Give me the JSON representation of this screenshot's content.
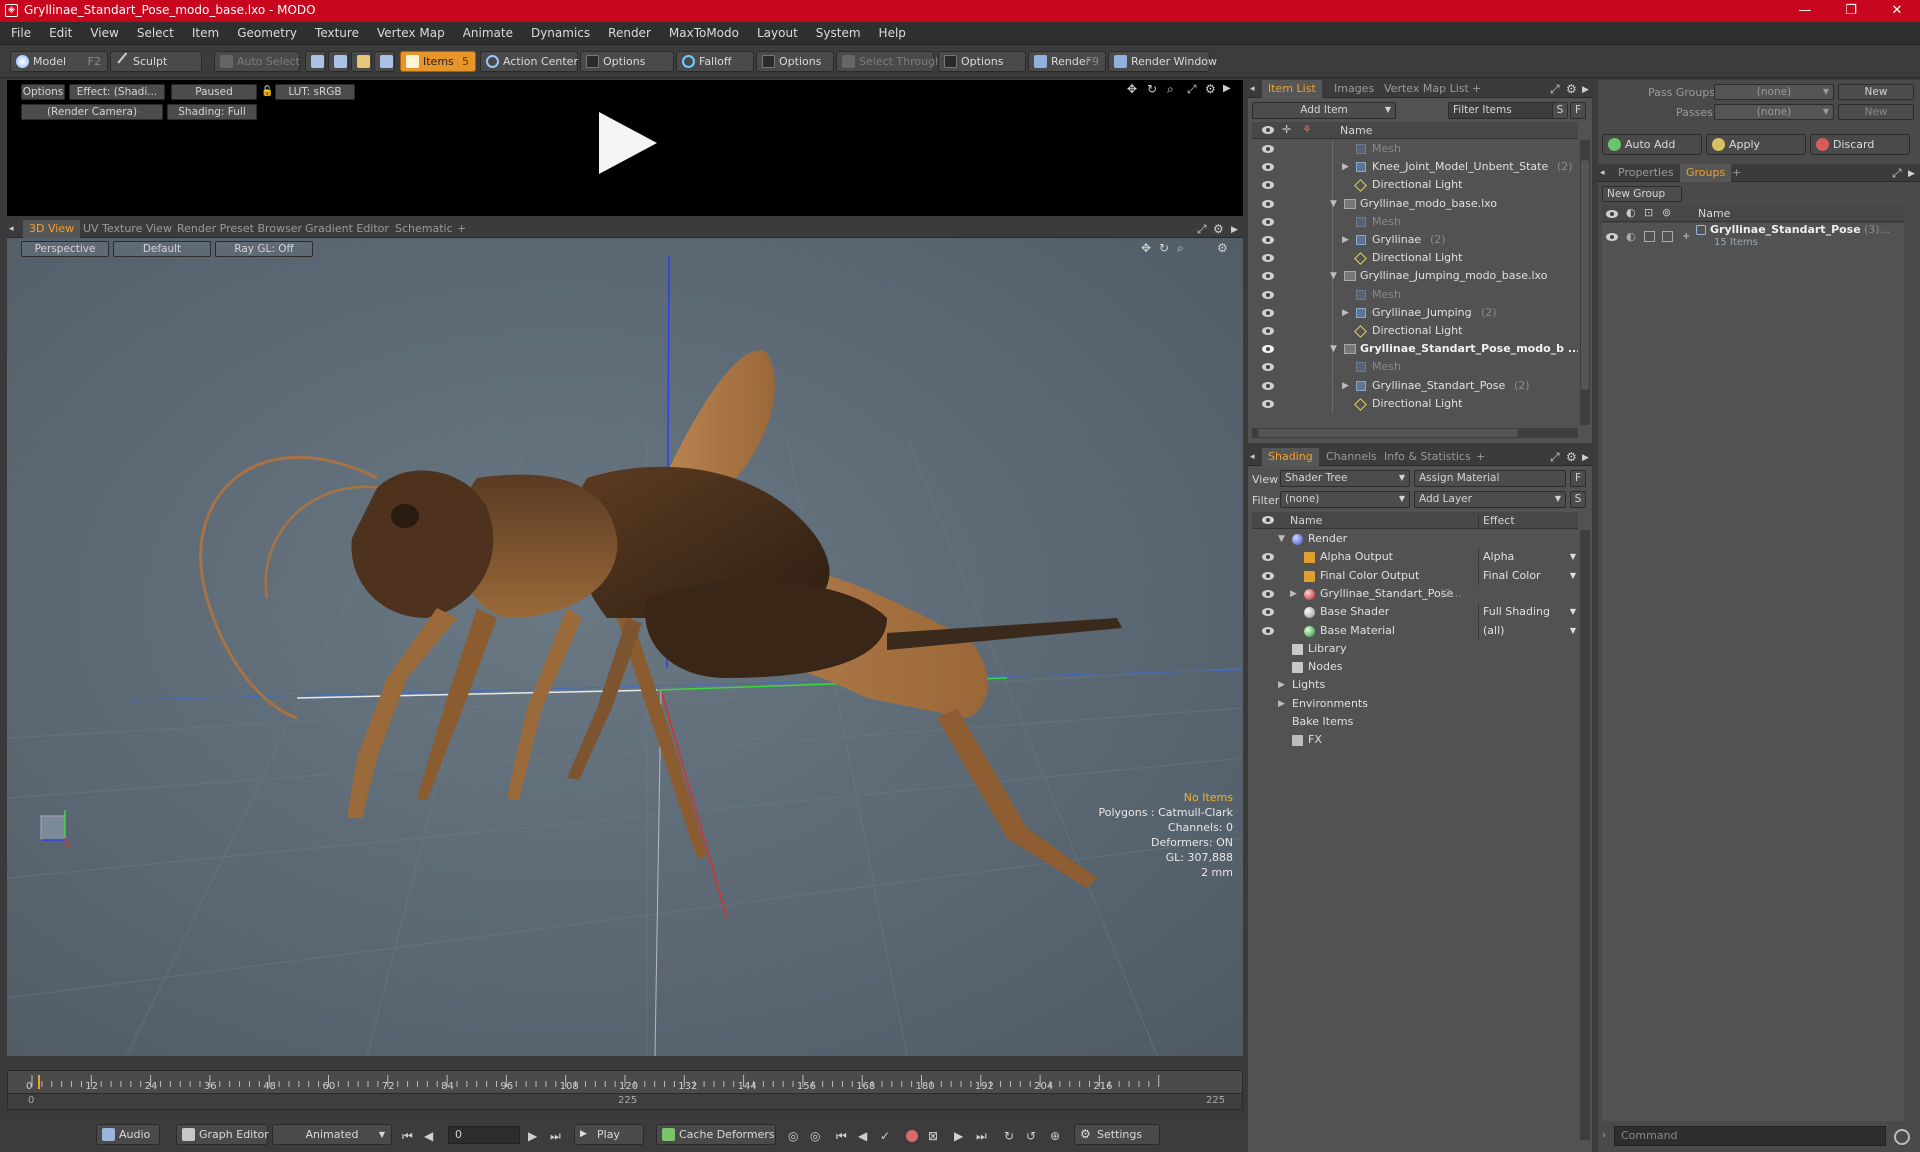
{
  "window": {
    "title": "Gryllinae_Standart_Pose_modo_base.lxo - MODO",
    "minimize": "—",
    "maximize": "❐",
    "close": "✕"
  },
  "menu": [
    "File",
    "Edit",
    "View",
    "Select",
    "Item",
    "Geometry",
    "Texture",
    "Vertex Map",
    "Animate",
    "Dynamics",
    "Render",
    "MaxToModo",
    "Layout",
    "System",
    "Help"
  ],
  "toolbar": {
    "model": "Model",
    "model_key": "F2",
    "sculpt": "Sculpt",
    "auto_select": "Auto Select",
    "items": "Items",
    "items_key": "5",
    "action_center": "Action Center",
    "options1": "Options",
    "falloff": "Falloff",
    "options2": "Options",
    "select_through": "Select Through",
    "options3": "Options",
    "render": "Render",
    "render_key": "F9",
    "render_window": "Render Window"
  },
  "preview": {
    "options": "Options",
    "effect": "Effect: (Shadi...",
    "paused": "Paused",
    "lut": "LUT: sRGB",
    "camera": "(Render Camera)",
    "shading": "Shading: Full"
  },
  "viewport_tabs": [
    "3D View",
    "UV Texture View",
    "Render Preset Browser",
    "Gradient Editor",
    "Schematic",
    "+"
  ],
  "viewport": {
    "perspective": "Perspective",
    "default": "Default",
    "raygl": "Ray GL: Off",
    "info": {
      "no_items": "No Items",
      "polygons": "Polygons : Catmull-Clark",
      "channels": "Channels: 0",
      "deformers": "Deformers: ON",
      "gl": "GL: 307,888",
      "scale": "2 mm"
    }
  },
  "timeline": {
    "ticks": [
      "0",
      "12",
      "24",
      "36",
      "48",
      "60",
      "72",
      "84",
      "96",
      "108",
      "120",
      "132",
      "144",
      "156",
      "168",
      "180",
      "192",
      "204",
      "216"
    ],
    "start": "0",
    "mid": "225",
    "end": "225"
  },
  "transport": {
    "audio": "Audio",
    "graph_editor": "Graph Editor",
    "animated": "Animated",
    "frame": "0",
    "play": "Play",
    "cache": "Cache Deformers",
    "settings": "Settings"
  },
  "item_list": {
    "tabs": [
      "Item List",
      "Images",
      "Vertex Map List",
      "+"
    ],
    "add_item": "Add Item",
    "filter": "Filter Items",
    "s": "S",
    "f": "F",
    "col_name": "Name",
    "rows": [
      {
        "label": "Mesh",
        "count": "",
        "type": "mesh",
        "indent": 2,
        "dim": true,
        "arrow": "",
        "bold": false
      },
      {
        "label": "Knee_Joint_Model_Unbent_State",
        "count": "(2)",
        "type": "mesh",
        "indent": 2,
        "dim": false,
        "arrow": "▶",
        "bold": false
      },
      {
        "label": "Directional Light",
        "count": "",
        "type": "light",
        "indent": 2,
        "dim": false,
        "arrow": "",
        "bold": false
      },
      {
        "label": "Gryllinae_modo_base.lxo",
        "count": "",
        "type": "scene",
        "indent": 1,
        "dim": false,
        "arrow": "▼",
        "bold": false
      },
      {
        "label": "Mesh",
        "count": "",
        "type": "mesh",
        "indent": 2,
        "dim": true,
        "arrow": "",
        "bold": false
      },
      {
        "label": "Gryllinae",
        "count": "(2)",
        "type": "mesh",
        "indent": 2,
        "dim": false,
        "arrow": "▶",
        "bold": false
      },
      {
        "label": "Directional Light",
        "count": "",
        "type": "light",
        "indent": 2,
        "dim": false,
        "arrow": "",
        "bold": false
      },
      {
        "label": "Gryllinae_Jumping_modo_base.lxo",
        "count": "",
        "type": "scene",
        "indent": 1,
        "dim": false,
        "arrow": "▼",
        "bold": false
      },
      {
        "label": "Mesh",
        "count": "",
        "type": "mesh",
        "indent": 2,
        "dim": true,
        "arrow": "",
        "bold": false
      },
      {
        "label": "Gryllinae_Jumping",
        "count": "(2)",
        "type": "mesh",
        "indent": 2,
        "dim": false,
        "arrow": "▶",
        "bold": false
      },
      {
        "label": "Directional Light",
        "count": "",
        "type": "light",
        "indent": 2,
        "dim": false,
        "arrow": "",
        "bold": false
      },
      {
        "label": "Gryllinae_Standart_Pose_modo_b ...",
        "count": "",
        "type": "scene",
        "indent": 1,
        "dim": false,
        "arrow": "▼",
        "bold": true
      },
      {
        "label": "Mesh",
        "count": "",
        "type": "mesh",
        "indent": 2,
        "dim": true,
        "arrow": "",
        "bold": false
      },
      {
        "label": "Gryllinae_Standart_Pose",
        "count": "(2)",
        "type": "mesh",
        "indent": 2,
        "dim": false,
        "arrow": "▶",
        "bold": false
      },
      {
        "label": "Directional Light",
        "count": "",
        "type": "light",
        "indent": 2,
        "dim": false,
        "arrow": "",
        "bold": false
      }
    ]
  },
  "shading": {
    "tabs": [
      "Shading",
      "Channels",
      "Info & Statistics",
      "+"
    ],
    "view_label": "View",
    "view_value": "Shader Tree",
    "assign": "Assign Material",
    "f": "F",
    "filter_label": "Filter",
    "filter_value": "(none)",
    "add_layer": "Add Layer",
    "s": "S",
    "col_name": "Name",
    "col_effect": "Effect",
    "rows": [
      {
        "label": "Render",
        "effect": "",
        "indent": 1,
        "arrow": "▼",
        "eye": false,
        "icon": "sphere-blue"
      },
      {
        "label": "Alpha Output",
        "effect": "Alpha",
        "indent": 2,
        "arrow": "",
        "eye": true,
        "icon": "output"
      },
      {
        "label": "Final Color Output",
        "effect": "Final Color",
        "indent": 2,
        "arrow": "",
        "eye": true,
        "icon": "output"
      },
      {
        "label": "Gryllinae_Standart_Pose",
        "effect": "",
        "count": "(2...",
        "indent": 2,
        "arrow": "▶",
        "eye": true,
        "icon": "group-red"
      },
      {
        "label": "Base Shader",
        "effect": "Full Shading",
        "indent": 2,
        "arrow": "",
        "eye": true,
        "icon": "sphere-white"
      },
      {
        "label": "Base Material",
        "effect": "(all)",
        "indent": 2,
        "arrow": "",
        "eye": true,
        "icon": "sphere-green"
      },
      {
        "label": "Library",
        "effect": "",
        "indent": 1,
        "arrow": "",
        "eye": false,
        "icon": "folder"
      },
      {
        "label": "Nodes",
        "effect": "",
        "indent": 1,
        "arrow": "",
        "eye": false,
        "icon": "folder"
      },
      {
        "label": "Lights",
        "effect": "",
        "indent": 0,
        "arrow": "▶",
        "eye": false,
        "icon": ""
      },
      {
        "label": "Environments",
        "effect": "",
        "indent": 0,
        "arrow": "▶",
        "eye": false,
        "icon": ""
      },
      {
        "label": "Bake Items",
        "effect": "",
        "indent": 0,
        "arrow": "",
        "eye": false,
        "icon": ""
      },
      {
        "label": "FX",
        "effect": "",
        "indent": 1,
        "arrow": "",
        "eye": false,
        "icon": "clapper"
      }
    ]
  },
  "passes": {
    "pass_groups": "Pass Groups",
    "passes": "Passes",
    "none1": "(none)",
    "none2": "(none)",
    "new1": "New",
    "new2": "New",
    "auto_add": "Auto Add",
    "apply": "Apply",
    "discard": "Discard"
  },
  "groups": {
    "tabs": [
      "Properties",
      "Groups",
      "+"
    ],
    "new_group": "New Group",
    "col_name": "Name",
    "group_name": "Gryllinae_Standart_Pose",
    "group_count": "(3)...",
    "group_items": "15 Items"
  },
  "command": {
    "placeholder": "Command"
  },
  "colors": {
    "title": "#c8071e",
    "accent": "#f0a030",
    "axis_x": "#d8302a",
    "axis_y": "#3ad83a",
    "axis_z": "#2a42e0"
  }
}
